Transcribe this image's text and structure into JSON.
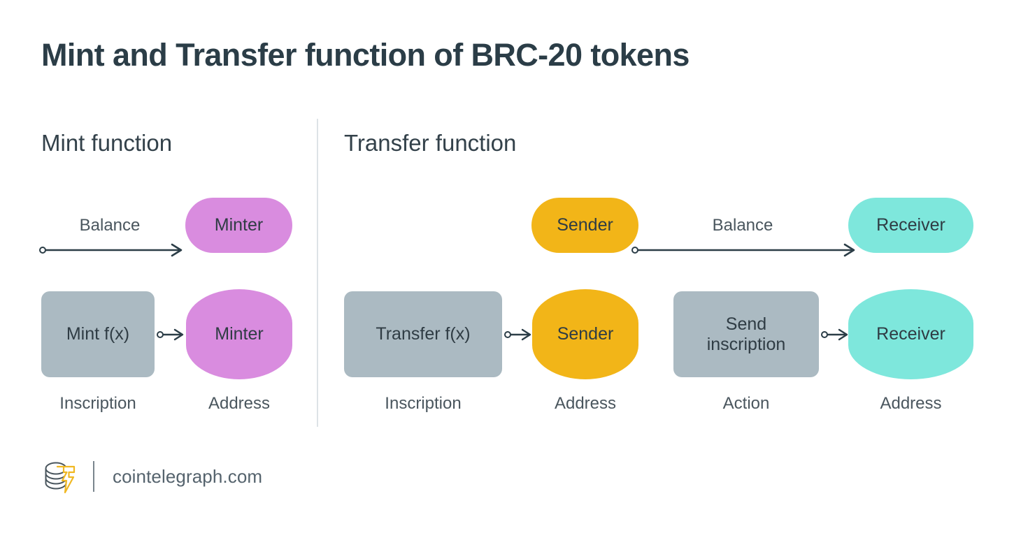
{
  "page": {
    "title": "Mint and Transfer function of BRC-20 tokens",
    "background_color": "#ffffff",
    "title_color": "#2b3d47"
  },
  "colors": {
    "minter_pink": "#d98cdf",
    "sender_orange": "#f2b518",
    "receiver_teal": "#7ee7dc",
    "inscription_gray": "#abbac2",
    "arrow_dark": "#2b3d47",
    "divider_gray": "#dde3e7",
    "caption_gray": "#4a565e",
    "logo_gold": "#f0b823",
    "logo_dark": "#4a565e"
  },
  "sections": [
    {
      "id": "mint",
      "heading": "Mint function",
      "flow_top": {
        "edge_label": "Balance",
        "target_node": {
          "label": "Minter",
          "shape": "pill",
          "color": "minter_pink"
        }
      },
      "flow_bottom": {
        "source_node": {
          "label": "Mint f(x)",
          "shape": "rect",
          "color": "inscription_gray"
        },
        "target_node": {
          "label": "Minter",
          "shape": "oval",
          "color": "minter_pink"
        },
        "source_caption": "Inscription",
        "target_caption": "Address"
      }
    },
    {
      "id": "transfer",
      "heading": "Transfer function",
      "flow_top": {
        "source_node": {
          "label": "Sender",
          "shape": "pill",
          "color": "sender_orange"
        },
        "edge_label": "Balance",
        "target_node": {
          "label": "Receiver",
          "shape": "pill",
          "color": "receiver_teal"
        }
      },
      "flow_bottom": {
        "pairs": [
          {
            "source_node": {
              "label": "Transfer f(x)",
              "shape": "rect",
              "color": "inscription_gray"
            },
            "target_node": {
              "label": "Sender",
              "shape": "oval",
              "color": "sender_orange"
            },
            "source_caption": "Inscription",
            "target_caption": "Address"
          },
          {
            "source_node": {
              "label": "Send\ninscription",
              "shape": "rect",
              "color": "inscription_gray"
            },
            "target_node": {
              "label": "Receiver",
              "shape": "oval",
              "color": "receiver_teal"
            },
            "source_caption": "Action",
            "target_caption": "Address"
          }
        ]
      }
    }
  ],
  "footer": {
    "logo_name": "cointelegraph-logo",
    "site": "cointelegraph.com"
  }
}
